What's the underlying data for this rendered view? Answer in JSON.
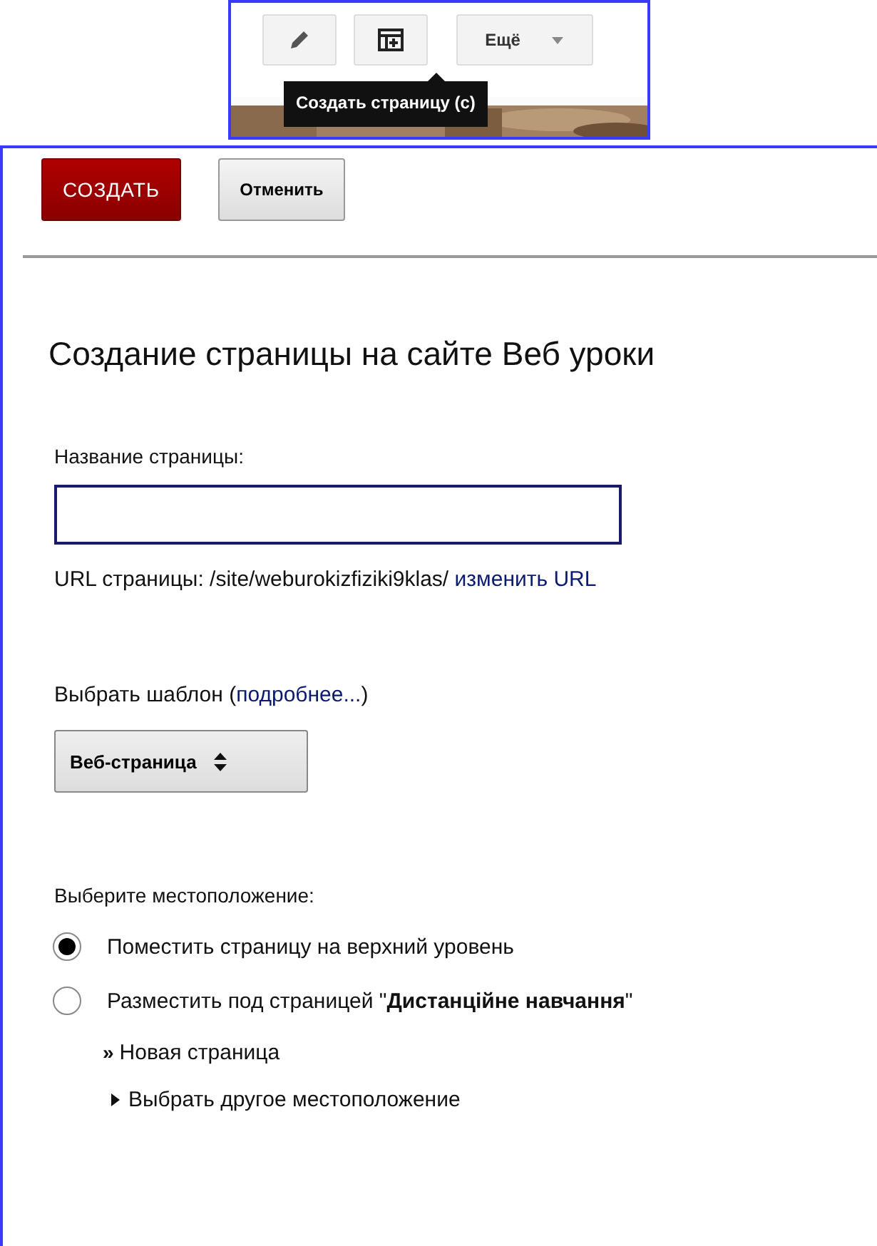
{
  "toolbar": {
    "more_button": "Ещё",
    "tooltip": "Создать страницу (c)"
  },
  "actions": {
    "create_button": "СОЗДАТЬ",
    "cancel_button": "Отменить"
  },
  "heading": "Создание страницы на сайте Веб уроки",
  "page_name": {
    "label": "Название страницы:"
  },
  "url": {
    "text": "URL страницы: /site/weburokizfiziki9klas/",
    "link": "изменить URL"
  },
  "template": {
    "label": "Выбрать шаблон (",
    "link": "подробнее...",
    "label_end": ")",
    "value": "Веб-страница"
  },
  "location": {
    "label": "Выберите местоположение:",
    "options": [
      {
        "label": "Поместить страницу на верхний уровень",
        "selected": true
      },
      {
        "label": "Разместить под страницей \"**Дистанційне навчання**\"",
        "selected": false
      }
    ],
    "new_page": {
      "mark": "»",
      "label": "Новая страница"
    },
    "other": "Выбрать другое местоположение"
  }
}
